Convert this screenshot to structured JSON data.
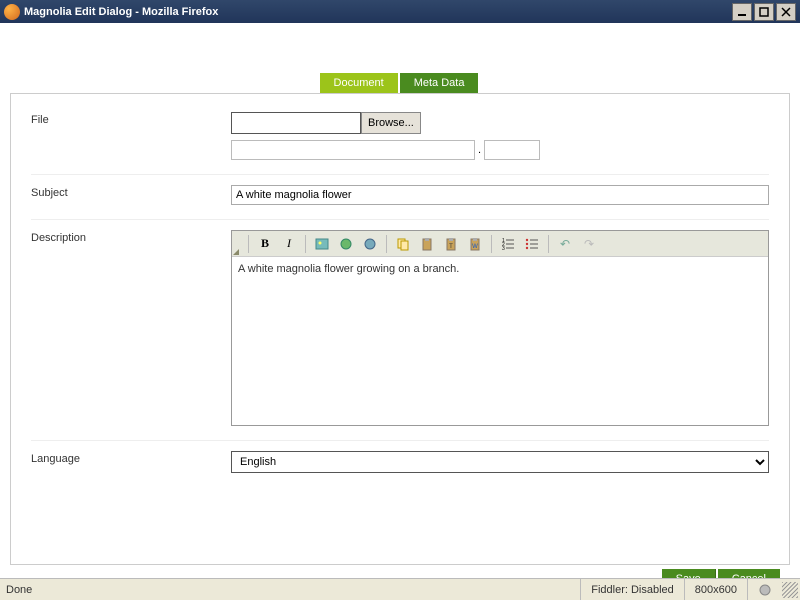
{
  "window": {
    "title": "Magnolia Edit Dialog - Mozilla Firefox"
  },
  "tabs": {
    "document": "Document",
    "metadata": "Meta Data"
  },
  "labels": {
    "file": "File",
    "subject": "Subject",
    "description": "Description",
    "language": "Language"
  },
  "fields": {
    "browse_button": "Browse...",
    "subject_value": "A white magnolia flower",
    "description_value": "A white magnolia flower growing on a branch.",
    "language_value": "English"
  },
  "file_field": {
    "dot": "."
  },
  "actions": {
    "save": "Save",
    "cancel": "Cancel"
  },
  "statusbar": {
    "done": "Done",
    "fiddler": "Fiddler: Disabled",
    "dimensions": "800x600"
  },
  "icons": {
    "bold": "B",
    "italic": "I",
    "image": "🖼",
    "bullets": "≡",
    "numbers": "≣",
    "undo": "↶",
    "redo": "↷"
  }
}
